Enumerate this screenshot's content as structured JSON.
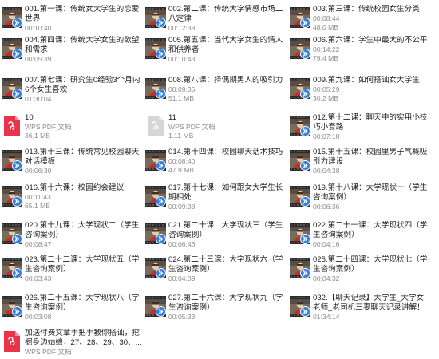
{
  "files": [
    {
      "type": "video",
      "name": "001.第一课：传统女大学生的恋爱世界！",
      "meta": [
        "00:10:40"
      ]
    },
    {
      "type": "video",
      "name": "002.第二课：传统大学情感市场二八定律",
      "meta": [
        "00:12:38"
      ]
    },
    {
      "type": "video",
      "name": "003.第三课：传统校园女生分类",
      "meta": [
        "00:08:44",
        "48.0 MB"
      ]
    },
    {
      "type": "video",
      "name": "004.第四课：传统大学女生的欲望和需求",
      "meta": [
        "00:05:39"
      ]
    },
    {
      "type": "video",
      "name": "005.第五课：当代大学女生的情人和供养者",
      "meta": [
        "00:10:43"
      ]
    },
    {
      "type": "video",
      "name": "006.第六课：学生中最大的不公平",
      "meta": [
        "00:14:22",
        "79.4 MB"
      ]
    },
    {
      "type": "video",
      "name": "007.第七课：研究生0经验3个月内6个女生喜欢",
      "meta": [
        "01:30:04"
      ]
    },
    {
      "type": "video",
      "name": "008.第八课：择偶期男人的吸引力",
      "meta": [
        "00:09:35",
        "51.1 MB"
      ]
    },
    {
      "type": "video",
      "name": "009.第九课：如何搭讪女大学生",
      "meta": [
        "00:05:29",
        "30.2 MB"
      ]
    },
    {
      "type": "pdf",
      "name": "10",
      "meta": [
        "WPS PDF 文档",
        "36.1 MB"
      ]
    },
    {
      "type": "pdf-gray",
      "name": "11",
      "meta": [
        "WPS PDF 文档",
        "1.11 MB"
      ]
    },
    {
      "type": "video",
      "name": "012.第十二课：聊天中的实用小技巧小套路",
      "meta": [
        "00:07:18"
      ]
    },
    {
      "type": "video",
      "name": "013.第十三课：传统常见校园聊天对话模板",
      "meta": [
        "00:06:30"
      ]
    },
    {
      "type": "video",
      "name": "014.第十四课：校园聊天话术技巧",
      "meta": [
        "00:08:40",
        "47.9 MB"
      ]
    },
    {
      "type": "video",
      "name": "015.第十五课：校园里男子气概吸引力建设",
      "meta": [
        "00:04:38"
      ]
    },
    {
      "type": "video",
      "name": "016.第十六课：校园约会建议",
      "meta": [
        "00:11:43",
        "65.1 MB"
      ]
    },
    {
      "type": "video",
      "name": "017.第十七课：如何跟女大学生长期相处",
      "meta": [
        "00:09:38"
      ]
    },
    {
      "type": "video",
      "name": "019.第十八课：大学现状一（学生咨询案例）",
      "meta": [
        "00:06:36"
      ]
    },
    {
      "type": "video",
      "name": "020.第十九课：大学现状二（学生咨询案例）",
      "meta": [
        "00:08:47"
      ]
    },
    {
      "type": "video",
      "name": "021.第二十课：大学现状三（学生咨询案例）",
      "meta": [
        "00:06:46"
      ]
    },
    {
      "type": "video",
      "name": "022.第二十一课：大学现状四（学生咨询案例）",
      "meta": [
        "00:04:16"
      ]
    },
    {
      "type": "video",
      "name": "023.第二十二课：大学现状五（学生咨询案例）",
      "meta": [
        "00:03:43"
      ]
    },
    {
      "type": "video",
      "name": "024.第二十三课：大学现状六（学生咨询案例）",
      "meta": [
        "00:04:39"
      ]
    },
    {
      "type": "video",
      "name": "025.第二十四课：大学现状七（学生咨询案例）",
      "meta": [
        "00:04:32"
      ]
    },
    {
      "type": "video",
      "name": "026.第二十五课：大学现状八（学生咨询案例）",
      "meta": [
        "00:03:08"
      ]
    },
    {
      "type": "video",
      "name": "027.第二十六课：大学现状九（学生咨询案例）",
      "meta": [
        "00:05:33"
      ]
    },
    {
      "type": "video",
      "name": "032.【聊天记录】大学生_大学女老师_老司机三妻聊天记录讲解！",
      "meta": [
        "01:34:14"
      ]
    },
    {
      "type": "pdf",
      "name": "加送付费文章手把手教你搭讪，挖掘身边姑娘，27、28、29、30、...",
      "meta": [
        "WPS PDF 文档"
      ]
    }
  ]
}
